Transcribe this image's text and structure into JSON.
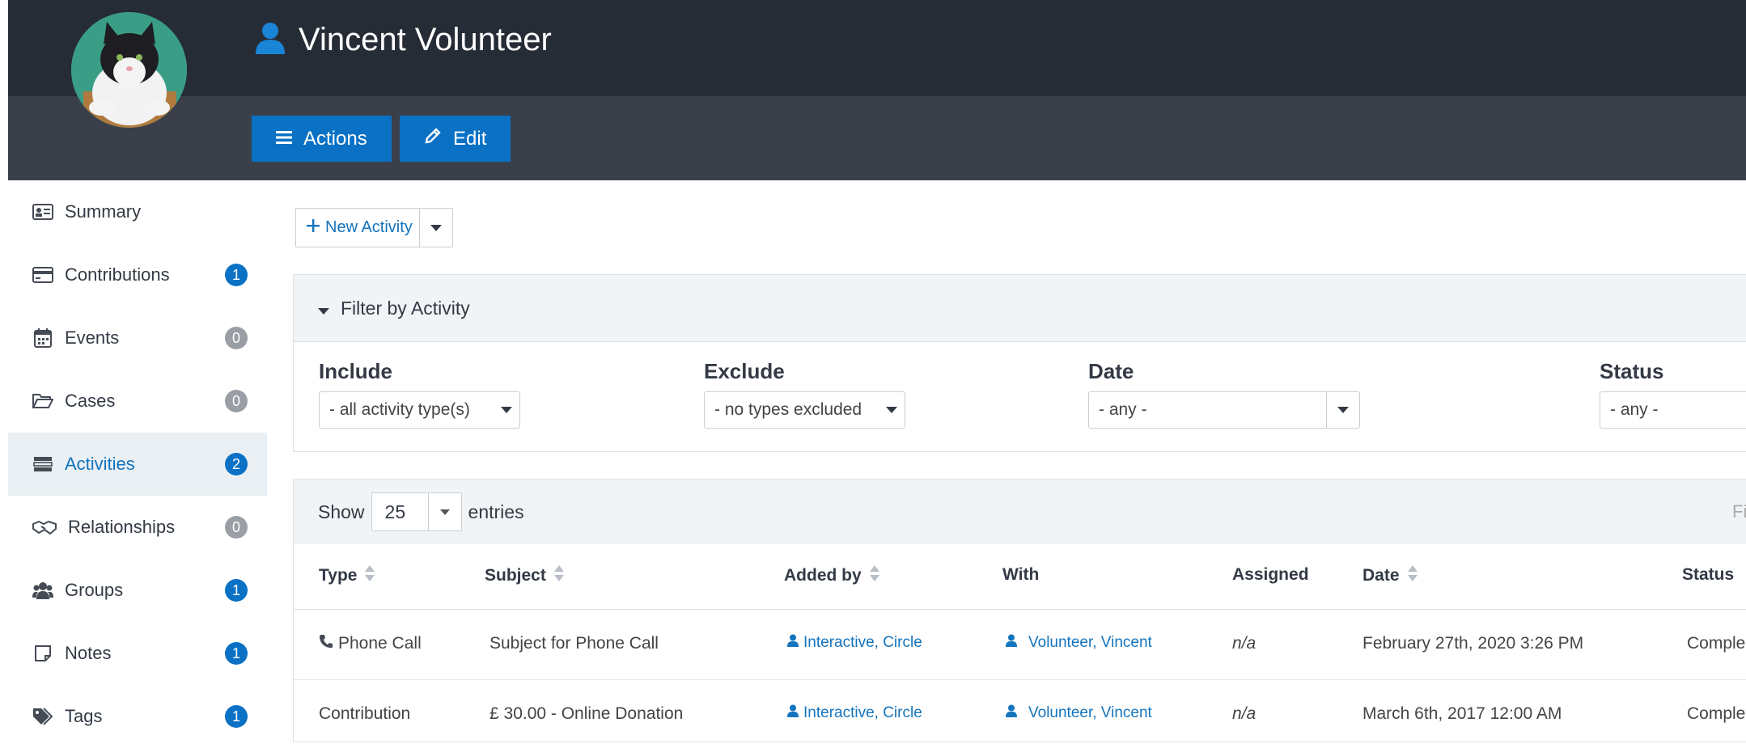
{
  "contact": {
    "name": "Vincent Volunteer"
  },
  "header": {
    "actions_label": "Actions",
    "edit_label": "Edit"
  },
  "sidebar": {
    "items": [
      {
        "label": "Summary",
        "icon": "id-card-icon",
        "count": null
      },
      {
        "label": "Contributions",
        "icon": "credit-card-icon",
        "count": "1"
      },
      {
        "label": "Events",
        "icon": "calendar-icon",
        "count": "0"
      },
      {
        "label": "Cases",
        "icon": "folder-open-icon",
        "count": "0"
      },
      {
        "label": "Activities",
        "icon": "tasks-icon",
        "count": "2",
        "active": true
      },
      {
        "label": "Relationships",
        "icon": "handshake-icon",
        "count": "0"
      },
      {
        "label": "Groups",
        "icon": "users-icon",
        "count": "1"
      },
      {
        "label": "Notes",
        "icon": "sticky-note-icon",
        "count": "1"
      },
      {
        "label": "Tags",
        "icon": "tags-icon",
        "count": "1"
      }
    ]
  },
  "toolbar": {
    "new_activity_label": "New Activity"
  },
  "filter": {
    "title": "Filter by Activity",
    "include_label": "Include",
    "include_value": "- all activity type(s)",
    "exclude_label": "Exclude",
    "exclude_value": "- no types excluded",
    "date_label": "Date",
    "date_value": "- any -",
    "status_label": "Status",
    "status_value": "- any -"
  },
  "table": {
    "show_label": "Show",
    "entries_value": "25",
    "entries_label": "entries",
    "filter_cut": "Fi",
    "columns": [
      "Type",
      "Subject",
      "Added by",
      "With",
      "Assigned",
      "Date",
      "Status"
    ],
    "rows": [
      {
        "type": "Phone Call",
        "subject": "Subject for Phone Call",
        "added_by": "Interactive, Circle",
        "with": "Volunteer, Vincent",
        "assigned": "n/a",
        "date": "February 27th, 2020 3:26 PM",
        "status": "Comple"
      },
      {
        "type": "Contribution",
        "subject": "£ 30.00 - Online Donation",
        "added_by": "Interactive, Circle",
        "with": "Volunteer, Vincent",
        "assigned": "n/a",
        "date": "March 6th, 2017 12:00 AM",
        "status": "Comple"
      }
    ]
  },
  "colors": {
    "header_dark": "#262c36",
    "header_mid": "#3a3f49",
    "primary": "#0a71c5",
    "link": "#1474bd"
  }
}
